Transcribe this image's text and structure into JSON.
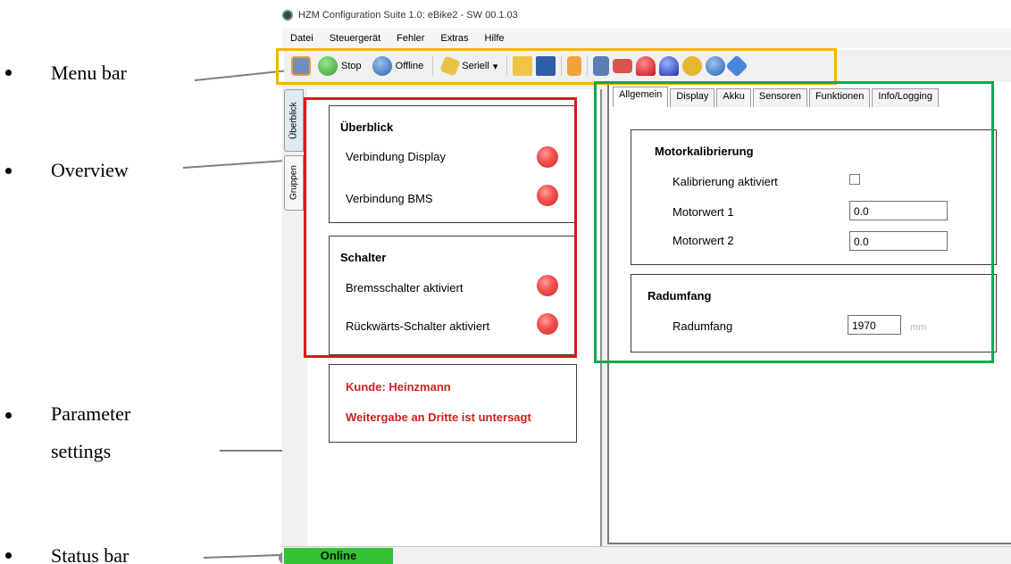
{
  "annotations": {
    "menu_bar": "Menu bar",
    "overview": "Overview",
    "parameter_settings_line1": "Parameter",
    "parameter_settings_line2": "settings",
    "status_bar": "Status bar"
  },
  "window": {
    "title": "HZM Configuration Suite 1.0: eBike2 - SW 00.1.03"
  },
  "menu": [
    "Datei",
    "Steuergerät",
    "Fehler",
    "Extras",
    "Hilfe"
  ],
  "toolbar": {
    "stop_label": "Stop",
    "offline_label": "Offline",
    "serial_label": "Seriell",
    "dropdown_arrow": "▾"
  },
  "side_tabs": [
    "Überblick",
    "Gruppen"
  ],
  "overview": {
    "title": "Überblick",
    "items": [
      "Verbindung Display",
      "Verbindung BMS"
    ]
  },
  "switches": {
    "title": "Schalter",
    "items": [
      "Bremsschalter aktiviert",
      "Rückwärts-Schalter aktiviert"
    ]
  },
  "customer": {
    "line1": "Kunde: Heinzmann",
    "line2": "Weitergabe an Dritte ist untersagt"
  },
  "tabs": [
    "Allgemein",
    "Display",
    "Akku",
    "Sensoren",
    "Funktionen",
    "Info/Logging"
  ],
  "motor_calibration": {
    "title": "Motorkalibrierung",
    "calibration_label": "Kalibrierung aktiviert",
    "motor1_label": "Motorwert 1",
    "motor1_value": "0.0",
    "motor2_label": "Motorwert 2",
    "motor2_value": "0.0"
  },
  "wheel": {
    "title": "Radumfang",
    "label": "Radumfang",
    "value": "1970",
    "unit": "mm"
  },
  "status": {
    "online_label": "Online"
  },
  "colors": {
    "overview_highlight": "#e3141b",
    "parameter_highlight": "#12a84f",
    "toolbar_highlight": "#f5b400",
    "online": "#33c233",
    "customer_text": "#d0211c",
    "led_red": "#f0504a"
  }
}
